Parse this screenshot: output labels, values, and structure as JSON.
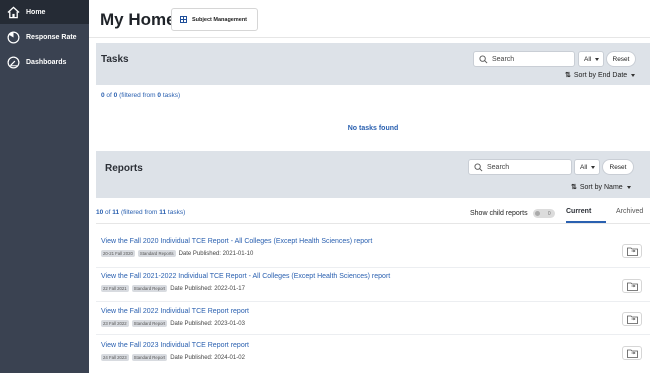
{
  "sidebar": {
    "items": [
      {
        "label": "Home",
        "icon": "home-icon"
      },
      {
        "label": "Response Rate",
        "icon": "response-rate-icon"
      },
      {
        "label": "Dashboards",
        "icon": "dashboard-gauge-icon"
      }
    ]
  },
  "header": {
    "title": "My Home",
    "subject_button": "Subject Management"
  },
  "tasks": {
    "title": "Tasks",
    "search_placeholder": "Search",
    "filter": "All",
    "reset": "Reset",
    "sort": "Sort by End Date",
    "count_prefix": "0",
    "count_mid": " of ",
    "count_total": "0",
    "count_filtered_pre": " (filtered from ",
    "count_filtered": "0",
    "count_suffix": " tasks)",
    "empty": "No tasks found"
  },
  "reports": {
    "title": "Reports",
    "search_placeholder": "Search",
    "filter": "All",
    "reset": "Reset",
    "sort": "Sort by Name",
    "count_prefix": "10",
    "count_mid": " of ",
    "count_total": "11",
    "count_filtered_pre": " (filtered from ",
    "count_filtered": "11",
    "count_suffix": " tasks)",
    "show_child": "Show child reports",
    "toggle_value": "0",
    "tab_current": "Current",
    "tab_archived": "Archived",
    "items": [
      {
        "title": "View the Fall 2020 Individual TCE Report - All Colleges (Except Health Sciences) report",
        "tag1": "20-21 Fall 2020",
        "tag2": "Standard Reports",
        "date": "Date Published: 2021-01-10"
      },
      {
        "title": "View the Fall 2021-2022 Individual TCE Report - All Colleges (Except Health Sciences) report",
        "tag1": "22 Fall 2021",
        "tag2": "Standard Report",
        "date": "Date Published: 2022-01-17"
      },
      {
        "title": "View the Fall 2022 Individual TCE Report report",
        "tag1": "23 Fall 2022",
        "tag2": "Standard Report",
        "date": "Date Published: 2023-01-03"
      },
      {
        "title": "View the Fall 2023 Individual TCE Report report",
        "tag1": "24 Fall 2023",
        "tag2": "Standard Report",
        "date": "Date Published: 2024-01-02"
      }
    ]
  },
  "colors": {
    "sidebar": "#3a4251",
    "sidebar_active": "#252b35",
    "band": "#dde2e8",
    "link": "#2a60b0"
  }
}
